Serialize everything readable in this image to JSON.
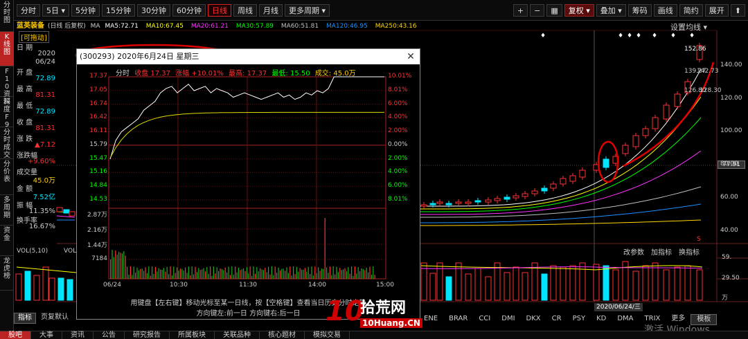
{
  "top_tabs": [
    "分时",
    "5日",
    "5分钟",
    "15分钟",
    "30分钟",
    "60分钟",
    "日线",
    "周线",
    "月线",
    "更多周期"
  ],
  "active_top_tab": "日线",
  "toolbar": {
    "plus": "+",
    "minus": "−",
    "grid": "▦",
    "adjust": "复权",
    "overlay": "叠加",
    "code": "筹码",
    "draw": "画线",
    "brief": "简约",
    "expand": "展开",
    "arrow": "⬆"
  },
  "sidebar": [
    "分时图",
    "K线图",
    "F10资料",
    "深度F9",
    "分时成交",
    "分价表",
    "多周期",
    "资金",
    "龙虎榜"
  ],
  "active_sidebar": "K线图",
  "stock": {
    "name": "蓝英装备",
    "period": "(日线 后复权)",
    "ma_label": "MA",
    "ma5": "MA5:72.71",
    "ma10": "MA10:67.45",
    "ma20": "MA20:61.21",
    "ma30": "MA30:57.89",
    "ma60": "MA60:51.81",
    "ma120": "MA120:46.95",
    "ma250": "MA250:43.16",
    "settings": "设置均线"
  },
  "data_panel": {
    "drag": "[可拖动]",
    "date_label": "日 期",
    "date_value1": "2020",
    "date_value2": "06/24",
    "open_label": "开 盘",
    "open_value": "72.89",
    "high_label": "最 高",
    "high_value": "81.31",
    "low_label": "最 低",
    "low_value": "72.89",
    "close_label": "收 盘",
    "close_value": "81.31",
    "change_label": "涨 跌",
    "change_value": "▲7.12",
    "pct_label": "涨跌幅",
    "pct_value": "+9.60%",
    "vol_label": "成交量",
    "vol_value": "45.0万",
    "amt_label": "金 额",
    "amt_value": "7.52亿",
    "amp_label": "振 幅",
    "amp_value": "11.35%",
    "turn_label": "换手率",
    "turn_value": "16.67%"
  },
  "price_axis": [
    "140.00",
    "120.00",
    "100.00",
    "80.00",
    "60.00",
    "40.00"
  ],
  "current_price_tag": "77.91",
  "price_annotations": [
    "152.86",
    "139.27",
    "142.73",
    "126.80",
    "128.30"
  ],
  "vol_panel": {
    "label": "VOL(5,10)",
    "label2": "VOL",
    "axis_top": "59.",
    "axis_mid": "29.50",
    "axis_bot": "万"
  },
  "right_labels": {
    "params": "改参数",
    "add_ind": "加指标",
    "swap_ind": "换指标"
  },
  "x_date_tag": "2020/06/24/三",
  "popup": {
    "title": "(300293) 2020年6月24日 星期三",
    "close": "✕",
    "info_label_ts": "分时",
    "info_close": "收盘 17.37",
    "info_chg": "涨幅 +10.01%",
    "info_high": "最高: 17.37",
    "info_low": "最低: 15.50",
    "info_vol": "成交: 45.0万",
    "left_axis": [
      "17.37",
      "17.05",
      "16.74",
      "16.42",
      "16.11",
      "15.79",
      "15.47",
      "15.16",
      "14.84",
      "14.53"
    ],
    "right_axis": [
      "10.01%",
      "8.01%",
      "6.00%",
      "4.00%",
      "2.00%",
      "0.00%",
      "2.00%",
      "4.00%",
      "6.00%",
      "8.01%"
    ],
    "vol_axis": [
      "2.87万",
      "2.16万",
      "1.44万",
      "7184"
    ],
    "times": [
      "06/24",
      "10:30",
      "11:30",
      "14:00",
      "15:00"
    ],
    "hint1": "用键盘【左右键】移动光标至某一日线，按【空格键】查看当日历史分时走势",
    "hint2": "方向键左:前一日   方向键右:后一日"
  },
  "bottom_side_tabs": [
    "指标",
    "页复默认"
  ],
  "indicators": [
    "ENE",
    "BRAR",
    "CCI",
    "DMI",
    "DKX",
    "CR",
    "PSY",
    "KD",
    "DMA",
    "TRIX",
    "更多",
    "模板"
  ],
  "active_indicator": "模板",
  "bottom_tabs": [
    "股吧",
    "大事",
    "资讯",
    "公告",
    "研究报告",
    "所属板块",
    "关联品种",
    "核心题材",
    "模拟交易"
  ],
  "active_bottom_tab": "股吧",
  "logo": {
    "big": "10",
    "text": "拾荒网",
    "sub": "10Huang.CN"
  },
  "watermark": "激活 Windows",
  "colors": {
    "up": "#ff3333",
    "down": "#00e5ff",
    "ma5": "#ffffff",
    "ma10": "#ffff00",
    "ma20": "#ff33ff",
    "ma30": "#00ff00",
    "ma60": "#c0c0c0",
    "ma120": "#1e90ff",
    "ma250": "#ffd700",
    "annotation": "#e00000"
  }
}
